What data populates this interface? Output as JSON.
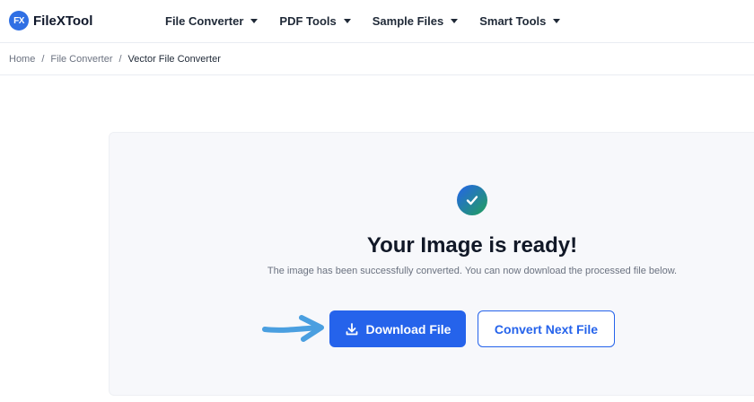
{
  "header": {
    "logo_badge": "FX",
    "logo_text": "FileXTool",
    "nav": [
      {
        "label": "File Converter"
      },
      {
        "label": "PDF Tools"
      },
      {
        "label": "Sample Files"
      },
      {
        "label": "Smart Tools"
      }
    ]
  },
  "breadcrumb": {
    "items": [
      "Home",
      "File Converter",
      "Vector File Converter"
    ],
    "separator": "/"
  },
  "result": {
    "title": "Your Image is ready!",
    "subtitle": "The image has been successfully converted. You can now download the processed file below.",
    "download_label": "Download File",
    "convert_next_label": "Convert Next File"
  },
  "colors": {
    "accent": "#2563eb",
    "success": "#22a05b",
    "annotation_arrow": "#4a9fe0"
  },
  "icons": {
    "logo": "fx-badge-icon",
    "nav_dropdown": "caret-down-icon",
    "success": "checkmark-circle-icon",
    "download": "download-icon",
    "annotation": "pointer-arrow-icon"
  }
}
